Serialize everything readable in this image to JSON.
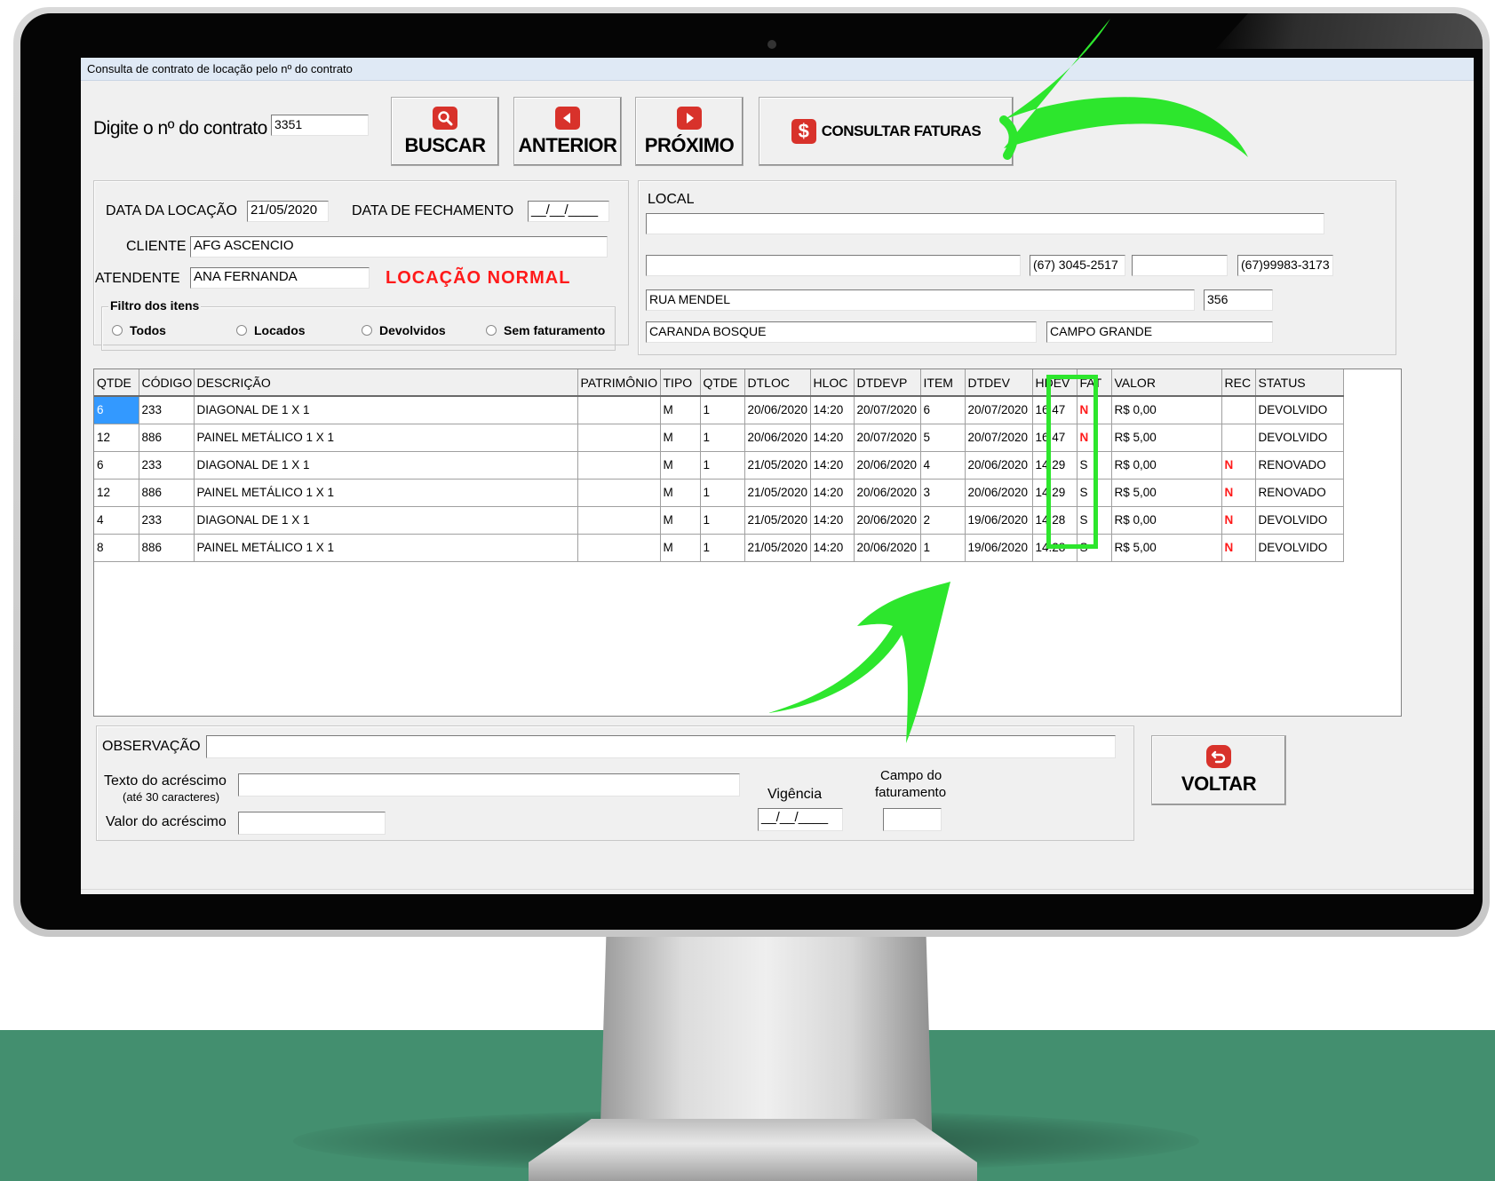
{
  "window": {
    "title": "Consulta de contrato de locação pelo nº do contrato"
  },
  "search": {
    "label": "Digite o nº do contrato",
    "contract_number": "3351"
  },
  "buttons": {
    "buscar": "BUSCAR",
    "anterior": "ANTERIOR",
    "proximo": "PRÓXIMO",
    "consultar_faturas": "CONSULTAR FATURAS",
    "voltar": "VOLTAR"
  },
  "contract": {
    "data_locacao_label": "DATA DA LOCAÇÃO",
    "data_locacao": "21/05/2020",
    "data_fechamento_label": "DATA DE FECHAMENTO",
    "data_fechamento": "__/__/____",
    "cliente_label": "CLIENTE",
    "cliente": "AFG ASCENCIO",
    "atendente_label": "ATENDENTE",
    "atendente": "ANA FERNANDA",
    "status": "LOCAÇÃO NORMAL"
  },
  "filter": {
    "title": "Filtro dos itens",
    "options": [
      "Todos",
      "Locados",
      "Devolvidos",
      "Sem faturamento"
    ]
  },
  "local": {
    "label": "LOCAL",
    "line1": "",
    "line2": "",
    "phone1": "(67) 3045-2517",
    "phone2": "",
    "phone3": "(67)99983-3173",
    "street": "RUA MENDEL",
    "number": "356",
    "district": "CARANDA BOSQUE",
    "city": "CAMPO GRANDE"
  },
  "grid": {
    "columns": [
      "QTDE",
      "CÓDIGO",
      "DESCRIÇÃO",
      "PATRIMÔNIO",
      "TIPO",
      "QTDE",
      "DTLOC",
      "HLOC",
      "DTDEVP",
      "ITEM",
      "DTDEV",
      "HDEV",
      "FAT",
      "VALOR",
      "REC",
      "STATUS"
    ],
    "rows": [
      [
        "6",
        "233",
        "DIAGONAL DE 1 X 1",
        "",
        "M",
        "1",
        "20/06/2020",
        "14:20",
        "20/07/2020",
        "6",
        "20/07/2020",
        "16:47",
        "N",
        "R$ 0,00",
        "",
        "DEVOLVIDO"
      ],
      [
        "12",
        "886",
        "PAINEL METÁLICO 1 X 1",
        "",
        "M",
        "1",
        "20/06/2020",
        "14:20",
        "20/07/2020",
        "5",
        "20/07/2020",
        "16:47",
        "N",
        "R$ 5,00",
        "",
        "DEVOLVIDO"
      ],
      [
        "6",
        "233",
        "DIAGONAL DE 1 X 1",
        "",
        "M",
        "1",
        "21/05/2020",
        "14:20",
        "20/06/2020",
        "4",
        "20/06/2020",
        "14:29",
        "S",
        "R$ 0,00",
        "N",
        "RENOVADO"
      ],
      [
        "12",
        "886",
        "PAINEL METÁLICO 1 X 1",
        "",
        "M",
        "1",
        "21/05/2020",
        "14:20",
        "20/06/2020",
        "3",
        "20/06/2020",
        "14:29",
        "S",
        "R$ 5,00",
        "N",
        "RENOVADO"
      ],
      [
        "4",
        "233",
        "DIAGONAL DE 1 X 1",
        "",
        "M",
        "1",
        "21/05/2020",
        "14:20",
        "20/06/2020",
        "2",
        "19/06/2020",
        "14:28",
        "S",
        "R$ 0,00",
        "N",
        "DEVOLVIDO"
      ],
      [
        "8",
        "886",
        "PAINEL METÁLICO 1 X 1",
        "",
        "M",
        "1",
        "21/05/2020",
        "14:20",
        "20/06/2020",
        "1",
        "19/06/2020",
        "14:28",
        "S",
        "R$ 5,00",
        "N",
        "DEVOLVIDO"
      ]
    ]
  },
  "bottom": {
    "observacao_label": "OBSERVAÇÃO",
    "observacao": "",
    "texto_acrescimo_label": "Texto do acréscimo",
    "texto_acrescimo_hint": "(até 30 caracteres)",
    "texto_acrescimo": "",
    "valor_acrescimo_label": "Valor do acréscimo",
    "valor_acrescimo": "",
    "vigencia_label": "Vigência",
    "vigencia": "__/__/____",
    "campo_faturamento_label_1": "Campo do",
    "campo_faturamento_label_2": "faturamento",
    "campo_faturamento": ""
  },
  "icons": {
    "buscar": "magnifier-icon",
    "anterior": "left-arrow-icon",
    "proximo": "right-arrow-icon",
    "consultar_faturas": "dollar-icon",
    "voltar": "return-icon"
  },
  "colors": {
    "icon_red": "#d8322b",
    "status_red": "#ff1a1a",
    "annotation_green": "#2de62d",
    "background_green": "#438f6f",
    "selection_blue": "#3399ff"
  }
}
